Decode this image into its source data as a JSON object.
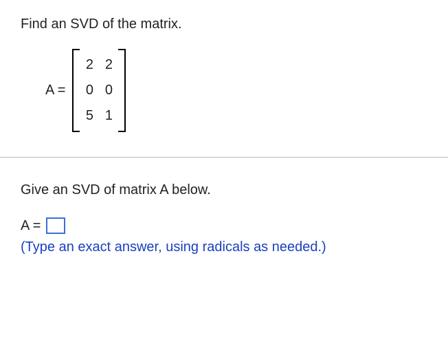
{
  "prompt": "Find an SVD of the matrix.",
  "equation_lhs": "A =",
  "matrix": {
    "rows": [
      [
        "2",
        "2"
      ],
      [
        "0",
        "0"
      ],
      [
        "5",
        "1"
      ]
    ]
  },
  "instruction": "Give an SVD of matrix A below.",
  "answer_lhs": "A =",
  "answer_value": "",
  "answer_placeholder": "",
  "hint": "(Type an exact answer, using radicals as needed.)"
}
